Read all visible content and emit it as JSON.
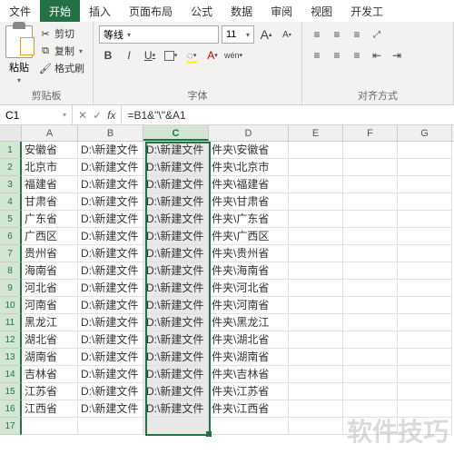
{
  "tabs": [
    "文件",
    "开始",
    "插入",
    "页面布局",
    "公式",
    "数据",
    "审阅",
    "视图",
    "开发工"
  ],
  "active_tab": 1,
  "clipboard": {
    "paste": "粘贴",
    "cut": "剪切",
    "copy": "复制",
    "format_painter": "格式刷",
    "group_label": "剪贴板"
  },
  "font": {
    "name": "等线",
    "size": "11",
    "grow": "A",
    "shrink": "A",
    "bold": "B",
    "italic": "I",
    "underline": "U",
    "wen": "wén",
    "group_label": "字体"
  },
  "alignment": {
    "group_label": "对齐方式"
  },
  "namebox": "C1",
  "formula": "=B1&\"\\\"&A1",
  "columns": [
    "A",
    "B",
    "C",
    "D",
    "E",
    "F",
    "G"
  ],
  "selected_col": "C",
  "rows": [
    {
      "n": "1",
      "a": "安徽省",
      "b": "D:\\新建文件",
      "c": "D:\\新建文件",
      "d": "件夹\\安徽省"
    },
    {
      "n": "2",
      "a": "北京市",
      "b": "D:\\新建文件",
      "c": "D:\\新建文件",
      "d": "件夹\\北京市"
    },
    {
      "n": "3",
      "a": "福建省",
      "b": "D:\\新建文件",
      "c": "D:\\新建文件",
      "d": "件夹\\福建省"
    },
    {
      "n": "4",
      "a": "甘肃省",
      "b": "D:\\新建文件",
      "c": "D:\\新建文件",
      "d": "件夹\\甘肃省"
    },
    {
      "n": "5",
      "a": "广东省",
      "b": "D:\\新建文件",
      "c": "D:\\新建文件",
      "d": "件夹\\广东省"
    },
    {
      "n": "6",
      "a": "广西区",
      "b": "D:\\新建文件",
      "c": "D:\\新建文件",
      "d": "件夹\\广西区"
    },
    {
      "n": "7",
      "a": "贵州省",
      "b": "D:\\新建文件",
      "c": "D:\\新建文件",
      "d": "件夹\\贵州省"
    },
    {
      "n": "8",
      "a": "海南省",
      "b": "D:\\新建文件",
      "c": "D:\\新建文件",
      "d": "件夹\\海南省"
    },
    {
      "n": "9",
      "a": "河北省",
      "b": "D:\\新建文件",
      "c": "D:\\新建文件",
      "d": "件夹\\河北省"
    },
    {
      "n": "10",
      "a": "河南省",
      "b": "D:\\新建文件",
      "c": "D:\\新建文件",
      "d": "件夹\\河南省"
    },
    {
      "n": "11",
      "a": "黑龙江",
      "b": "D:\\新建文件",
      "c": "D:\\新建文件",
      "d": "件夹\\黑龙江"
    },
    {
      "n": "12",
      "a": "湖北省",
      "b": "D:\\新建文件",
      "c": "D:\\新建文件",
      "d": "件夹\\湖北省"
    },
    {
      "n": "13",
      "a": "湖南省",
      "b": "D:\\新建文件",
      "c": "D:\\新建文件",
      "d": "件夹\\湖南省"
    },
    {
      "n": "14",
      "a": "吉林省",
      "b": "D:\\新建文件",
      "c": "D:\\新建文件",
      "d": "件夹\\吉林省"
    },
    {
      "n": "15",
      "a": "江苏省",
      "b": "D:\\新建文件",
      "c": "D:\\新建文件",
      "d": "件夹\\江苏省"
    },
    {
      "n": "16",
      "a": "江西省",
      "b": "D:\\新建文件",
      "c": "D:\\新建文件",
      "d": "件夹\\江西省"
    },
    {
      "n": "17",
      "a": "",
      "b": "",
      "c": "",
      "d": ""
    }
  ],
  "watermark": "软件技巧"
}
